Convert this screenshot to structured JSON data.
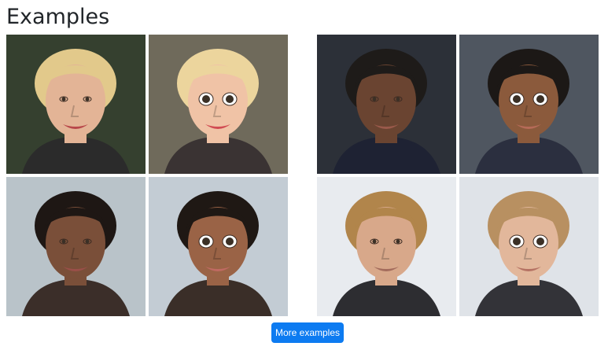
{
  "section": {
    "title": "Examples"
  },
  "examples": [
    {
      "row": 1,
      "side": "left",
      "photo": {
        "background": "#35402f",
        "skin": "#e3b496",
        "hair": "#e2c98b",
        "shirt": "#2b2b2b",
        "lips": "#b8474a"
      },
      "cartoon": {
        "background": "#6f6a5b",
        "skin": "#f0c3a6",
        "hair": "#ecd59d",
        "shirt": "#3a3333",
        "lips": "#d14b52"
      }
    },
    {
      "row": 1,
      "side": "right",
      "photo": {
        "background": "#2c3038",
        "skin": "#6a4431",
        "hair": "#1e1b19",
        "shirt": "#1e2233",
        "lips": "#9a5a4b"
      },
      "cartoon": {
        "background": "#4f5660",
        "skin": "#8b5a3c",
        "hair": "#1c1816",
        "shirt": "#2b2f3f",
        "lips": "#b66b58"
      }
    },
    {
      "row": 2,
      "side": "left",
      "photo": {
        "background": "#b9c3c9",
        "skin": "#7a4f39",
        "hair": "#1e1714",
        "shirt": "#3b2e29",
        "lips": "#9a4f49"
      },
      "cartoon": {
        "background": "#c3ccd4",
        "skin": "#9a6346",
        "hair": "#1f1814",
        "shirt": "#3a2e28",
        "lips": "#c06a62"
      }
    },
    {
      "row": 2,
      "side": "right",
      "photo": {
        "background": "#e8ebef",
        "skin": "#d8a88a",
        "hair": "#b1854b",
        "shirt": "#2d2d31",
        "lips": "#a46c5c"
      },
      "cartoon": {
        "background": "#dfe3e8",
        "skin": "#e2b79b",
        "hair": "#b89061",
        "shirt": "#333338",
        "lips": "#b57263"
      }
    }
  ],
  "footer": {
    "button_label": "More examples"
  }
}
